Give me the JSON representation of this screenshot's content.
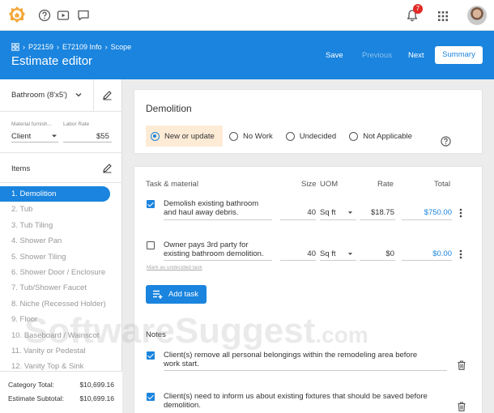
{
  "header": {
    "breadcrumb": [
      "P22159",
      "E72109 Info",
      "Scope"
    ],
    "title": "Estimate editor",
    "save": "Save",
    "previous": "Previous",
    "next": "Next",
    "summary": "Summary"
  },
  "notifications": {
    "count": "7"
  },
  "sidebar": {
    "room": "Bathroom (8'x5')",
    "material_label": "Material furnish...",
    "material_value": "Client",
    "labor_label": "Labor Rate",
    "labor_value": "$55",
    "items_label": "Items",
    "categories": [
      "1. Demolition",
      "2. Tub",
      "3. Tub Tiling",
      "4. Shower Pan",
      "5. Shower Tiling",
      "6. Shower Door / Enclosure",
      "7. Tub/Shower Faucet",
      "8. Niche (Recessed Holder)",
      "9. Floor",
      "10. Baseboard / Wainscot",
      "11. Vanity or Pedestal",
      "12. Vanity Top & Sink"
    ],
    "active_index": 0,
    "category_total_label": "Category Total:",
    "category_total": "$10,699.16",
    "estimate_subtotal_label": "Estimate Subtotal:",
    "estimate_subtotal": "$10,699.16"
  },
  "demolition": {
    "title": "Demolition",
    "options": [
      "New or update",
      "No Work",
      "Undecided",
      "Not Applicable"
    ],
    "selected": 0
  },
  "tasks": {
    "headers": {
      "task": "Task & material",
      "size": "Size",
      "uom": "UOM",
      "rate": "Rate",
      "total": "Total"
    },
    "rows": [
      {
        "checked": true,
        "line1": "Demolish existing bathroom",
        "line2": "and haul away debris.",
        "size": "40",
        "uom": "Sq ft",
        "rate": "$18.75",
        "total": "$750.00"
      },
      {
        "checked": false,
        "line1": "Owner pays 3rd party for",
        "line2": "existing bathroom demolition.",
        "size": "40",
        "uom": "Sq ft",
        "rate": "$0",
        "total": "$0.00"
      }
    ],
    "mark_link": "Mark as undecided task",
    "add_task": "Add task",
    "notes_label": "Notes",
    "notes": [
      {
        "checked": true,
        "line1": "Client(s) remove all personal belongings within the remodeling area before",
        "line2": "work start."
      },
      {
        "checked": true,
        "line1": "Client(s) need to inform us about existing fixtures that should be saved before",
        "line2": "demolition."
      }
    ]
  },
  "watermark": {
    "main": "SoftwareSuggest",
    "tld": ".com"
  },
  "colors": {
    "primary": "#1a84de",
    "selected_option_bg": "#fdebd6",
    "badge": "#e02b27"
  }
}
